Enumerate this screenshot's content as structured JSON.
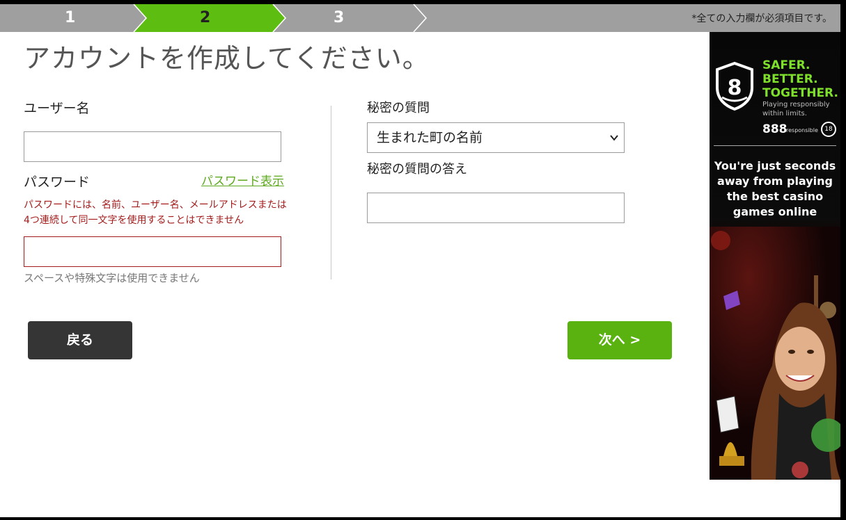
{
  "steps": [
    {
      "label": "1",
      "active": false
    },
    {
      "label": "2",
      "active": true
    },
    {
      "label": "3",
      "active": false
    }
  ],
  "required_note": "*全ての入力欄が必須項目です。",
  "title": "アカウントを作成してください。",
  "form": {
    "username_label": "ユーザー名",
    "username_value": "",
    "password_label": "パスワード",
    "show_password_link": "パスワード表示",
    "password_error": "パスワードには、名前、ユーザー名、メールアドレスまたは4つ連続して同一文字を使用することはできません",
    "password_value": "",
    "password_hint": "スペースや特殊文字は使用できません",
    "secret_question_label": "秘密の質問",
    "secret_question_value": "生まれた町の名前",
    "secret_answer_label": "秘密の質問の答え",
    "secret_answer_value": ""
  },
  "buttons": {
    "back": "戻る",
    "next": "次へ >"
  },
  "ad": {
    "headline": [
      "SAFER.",
      "BETTER.",
      "TOGETHER."
    ],
    "subline": [
      "Playing responsibly",
      "within limits."
    ],
    "brand": "888",
    "responsible": "responsible",
    "age": "18",
    "copy": [
      "You're just seconds",
      "away from playing",
      "the best casino",
      "games online"
    ]
  },
  "colors": {
    "accent": "#59b20f",
    "error": "#a31b1b",
    "stepbar": "#9f9f9f",
    "back_button": "#353535"
  }
}
